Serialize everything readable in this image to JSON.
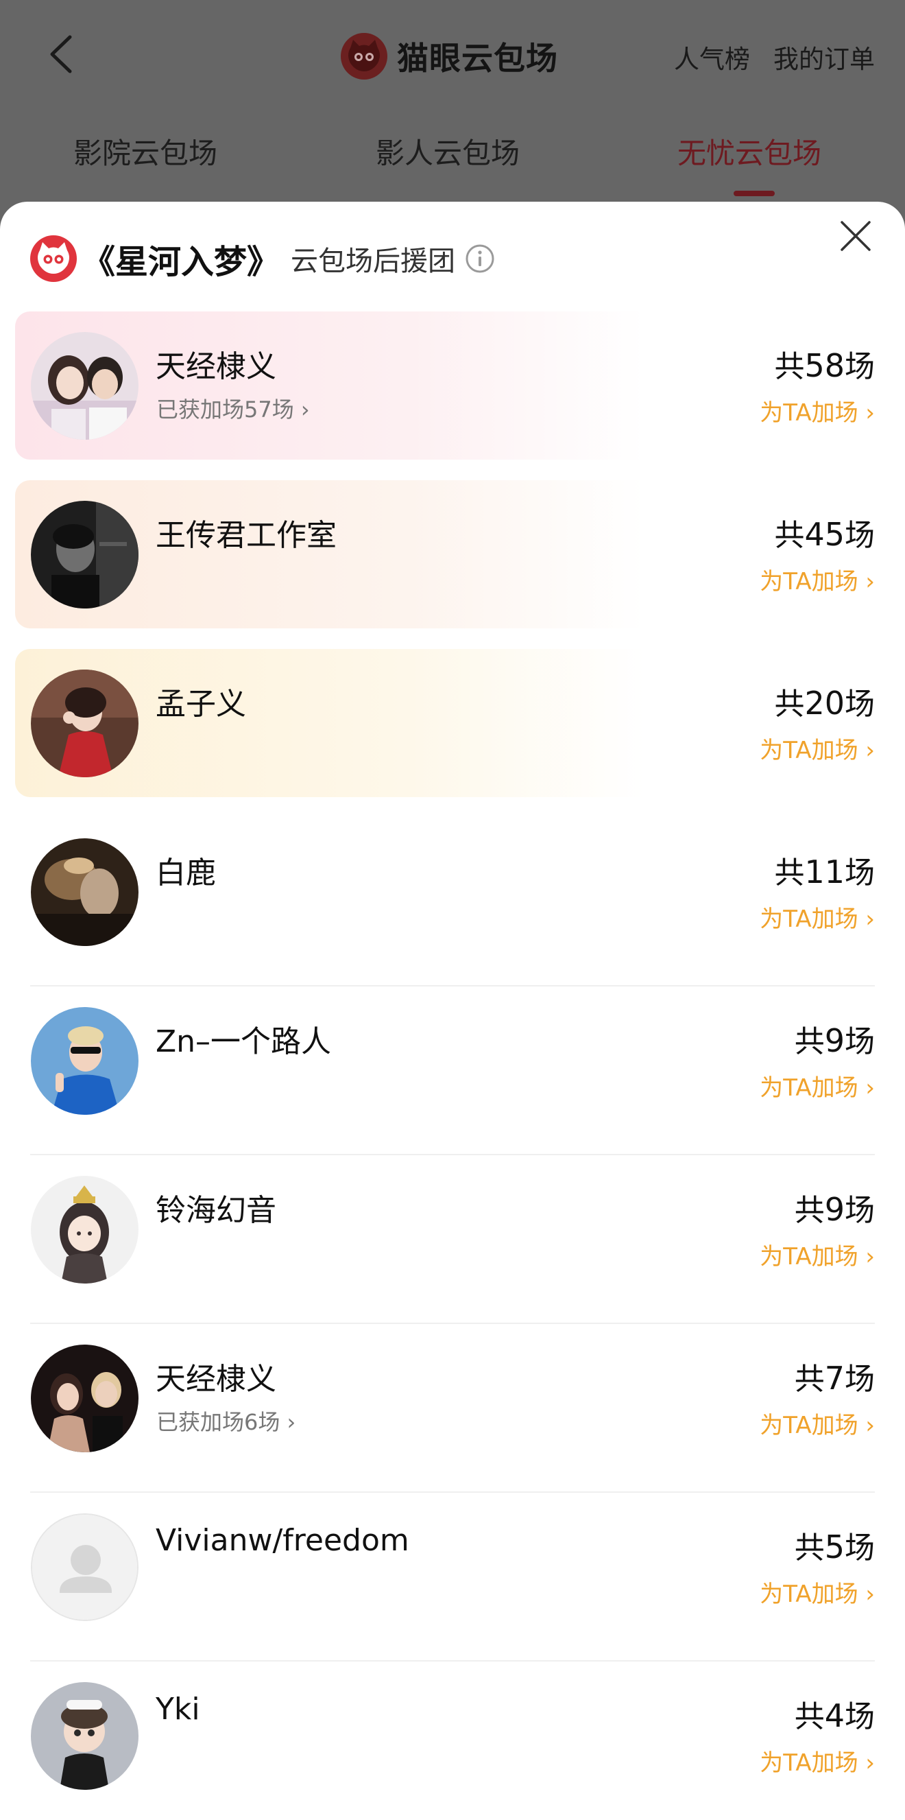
{
  "header": {
    "brand_title": "猫眼云包场",
    "links": [
      "人气榜",
      "我的订单"
    ],
    "tabs": [
      "影院云包场",
      "影人云包场",
      "无忧云包场"
    ],
    "active_tab": 2,
    "accent_color": "#6e1a20"
  },
  "sheet": {
    "title": "《星河入梦》",
    "subtitle": "云包场后援团",
    "accent_color": "#e0343d",
    "add_color": "#f0a22b"
  },
  "rows": [
    {
      "name": "天经棣义",
      "sub": "已获加场57场 ›",
      "prefix": "共",
      "count": "58",
      "suffix": "场",
      "add": "为TA加场 ›",
      "avatar_icon": "avatar-photo-couple"
    },
    {
      "name": "王传君工作室",
      "sub": "",
      "prefix": "共",
      "count": "45",
      "suffix": "场",
      "add": "为TA加场 ›",
      "avatar_icon": "avatar-photo-bw-portrait"
    },
    {
      "name": "孟子义",
      "sub": "",
      "prefix": "共",
      "count": "20",
      "suffix": "场",
      "add": "为TA加场 ›",
      "avatar_icon": "avatar-photo-red-dress"
    },
    {
      "name": "白鹿",
      "sub": "",
      "prefix": "共",
      "count": "11",
      "suffix": "场",
      "add": "为TA加场 ›",
      "avatar_icon": "avatar-photo-dark"
    },
    {
      "name": "Zn–一个路人",
      "sub": "",
      "prefix": "共",
      "count": "9",
      "suffix": "场",
      "add": "为TA加场 ›",
      "avatar_icon": "avatar-photo-blue"
    },
    {
      "name": "铃海幻音",
      "sub": "",
      "prefix": "共",
      "count": "9",
      "suffix": "场",
      "add": "为TA加场 ›",
      "avatar_icon": "avatar-illustration"
    },
    {
      "name": "天经棣义",
      "sub": "已获加场6场 ›",
      "prefix": "共",
      "count": "7",
      "suffix": "场",
      "add": "为TA加场 ›",
      "avatar_icon": "avatar-photo-event"
    },
    {
      "name": "Vivianw/freedom",
      "sub": "",
      "prefix": "共",
      "count": "5",
      "suffix": "场",
      "add": "为TA加场 ›",
      "avatar_icon": "avatar-default-person"
    },
    {
      "name": "Yki",
      "sub": "",
      "prefix": "共",
      "count": "4",
      "suffix": "场",
      "add": "为TA加场 ›",
      "avatar_icon": "avatar-photo-doll"
    }
  ]
}
